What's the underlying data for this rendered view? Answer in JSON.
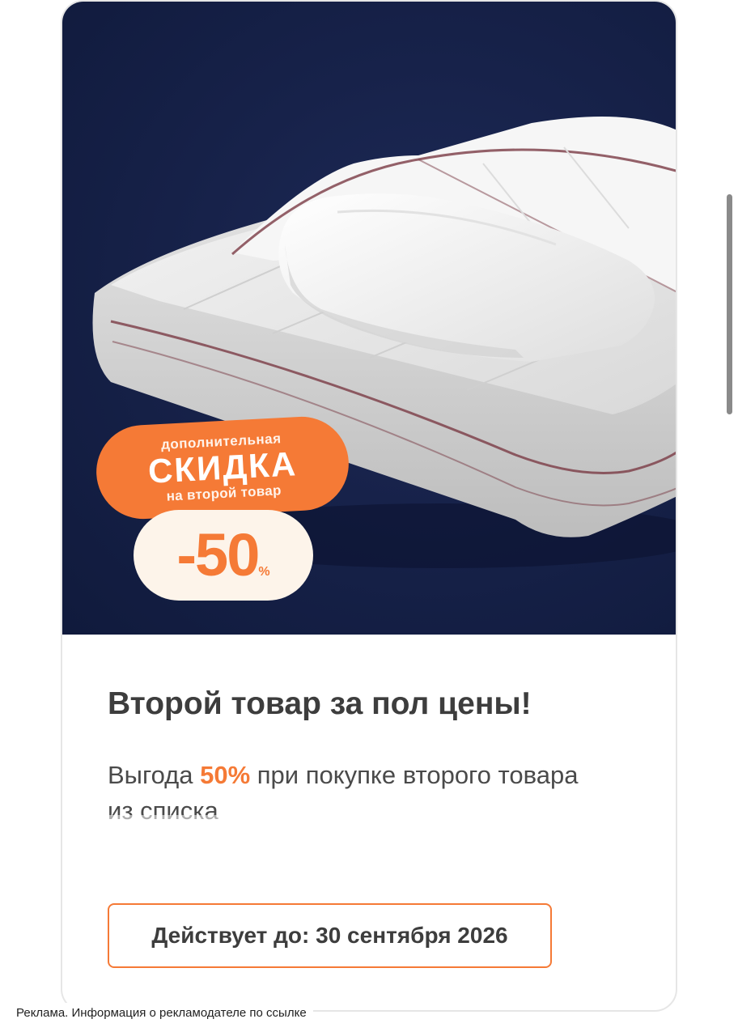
{
  "badge": {
    "line1": "дополнительная",
    "line2": "СКИДКА",
    "line3": "на второй товар"
  },
  "discount": {
    "value": "-50",
    "percent": "%"
  },
  "offer": {
    "title": "Второй товар за пол цены!",
    "subtitle_prefix": "Выгода ",
    "subtitle_accent": "50%",
    "subtitle_suffix": " при покупке второго товара из списка",
    "validity": "Действует до: 30 сентября 2026"
  },
  "ad_disclaimer": "Реклама. Информация о рекламодателе по ссылке",
  "colors": {
    "accent": "#f57a36",
    "hero_background": "#17224a",
    "text": "#3d3d3d"
  },
  "icons": {
    "product_image": "pillow-and-blanket-image"
  }
}
